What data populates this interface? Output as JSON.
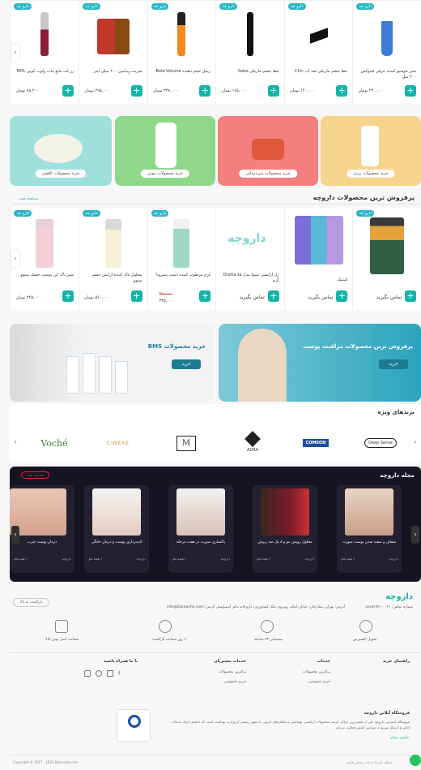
{
  "top_products": [
    {
      "name": "شیر خوشبو کننده عرقی فیتوکس ۲۰۰ میل"
    },
    {
      "name": "خط چشم ماژیکی ضد آب Chic"
    },
    {
      "name": "خط چشم ماژیکی Sobe"
    },
    {
      "name": "ریمل حجم دهنده Bold Volume"
    },
    {
      "name": "شربت ویتامین ۲۰۰ میلی لیتر"
    },
    {
      "name": "رژ لب مایع مات ولوت کوپی M01"
    }
  ],
  "top_prices": [
    "۲۴۰,۰۰۰ تومان",
    "۱۴۰,۰۰۰ تومان",
    "۱۶۵,۰۰۰ تومان",
    "۳۴۷,۰۰۰ تومان",
    "۲۹۵,۰۰۰ تومان",
    "۸۸,۲۰۰ تومان"
  ],
  "tag": "دارو چه",
  "categories": [
    "خرید محصولات پرتئ",
    "خرید محصولات بدن‌درمانی",
    "خرید محصولات بیوتی",
    "خرید محصولات کاهش"
  ],
  "bestsellers": {
    "title": "پرفروش ترین محصولات داروچه",
    "view_all": "مشاهده همه",
    "products": [
      {
        "name": "",
        "price": "تماس بگیرید"
      },
      {
        "name": "استیک",
        "price": "تماس بگیرید"
      },
      {
        "name": "ژل آرایشی نیتیوا مدل Orotta ۸۵ گرم",
        "price": "تماس بگیرید"
      },
      {
        "name": "کرم مرطوب کننده دست سیزونا",
        "price": "۳۴۵,۰۰۰"
      },
      {
        "name": "محلول پاک کننده آرایش چشم سیوو",
        "price": "۵۶۰,۰۰۰ تومان"
      },
      {
        "name": "شیر پاک کن پوست خشک سیوو",
        "price": "۴۴۵,۰۰۰ تومان"
      }
    ],
    "logo": "داروچه",
    "discount_old": "۴۶۰,۰۰۰"
  },
  "banners": {
    "right_title": "پرفروش ترین محصولات مراقبت پوست",
    "right_btn": "خرید",
    "left_title": "خرید محصولات BMS",
    "left_btn": "خرید"
  },
  "brands": {
    "title": "برندهای ویژه",
    "items": [
      "Deep Sense",
      "COMEON",
      "ADRA",
      "M",
      "CINERE",
      "Voché"
    ]
  },
  "magazine": {
    "title": "مجله داروچه",
    "view_all": "مشاهده همه",
    "posts": [
      {
        "title": "شفاف و سفید شدن پوست صورت",
        "author": "داروچه",
        "time": "۲ هفته قبل"
      },
      {
        "title": "محلول رویش مو و ۸ پک ضد ریزش",
        "author": "داروچه",
        "time": "۲ هفته قبل"
      },
      {
        "title": "پاکسازی صورت در هفت مرحله",
        "author": "داروچه",
        "time": "۲ هفته قبل"
      },
      {
        "title": "لایه‌برداری پوست و درمان خانگی",
        "author": "داروچه",
        "time": "۲ هفته قبل"
      },
      {
        "title": "درمان پوست چرب",
        "author": "داروچه",
        "time": "۲ هفته قبل"
      }
    ]
  },
  "footer": {
    "logo": "داروچه",
    "back_top": "بازگشت به بالا",
    "phone": "شماره تماس: ۰۲۱ - ۸۸۸۸۲۷۲۱",
    "address": "آدرس: تهران، ستارخان، خیابان امام، روبروی بانک کشاورزی، داروخانه دکتر امینی",
    "email": "ایمیل آدرس: info@Darooche.com",
    "features": [
      "تحویل اکسپرس",
      "پشتیبانی ۲۴ ساعته",
      "۷ روز ضمانت بازگشت",
      "ضمانت اصل بودن کالا"
    ],
    "cols": [
      {
        "title": "راهنمای خرید",
        "items": []
      },
      {
        "title": "خدمات",
        "items": [
          "پرکترین محصولات",
          "حریم خصوصی"
        ]
      },
      {
        "title": "خدمات مشتریان",
        "items": [
          "پرکترین محصولات",
          "حریم خصوصی"
        ]
      },
      {
        "title": "با ما همراه باشید",
        "items": []
      }
    ],
    "about_title": "فروشگاه آنلاین داروچه",
    "about_text": "فروشگاه اینترنتی داروچه یکی از معتبرترین مراکز عرضه محصولات آرایشی، بهداشتی و مکمل‌های دارویی با مجوز رسمی از وزارت بهداشت است که با هدف ارائه خدمات آنلاین و ارسال سریع به سراسر کشور فعالیت می‌کند.",
    "about_more": "نمایش بیشتر",
    "copyright": "Copyright © 2017 - 2023 Darooche.com",
    "chat": "سوالی دارید؟ با ما در تماس باشید"
  },
  "colors": {
    "accent": "#14b5a8",
    "tag": "#29b6c7",
    "dark": "#161421"
  }
}
